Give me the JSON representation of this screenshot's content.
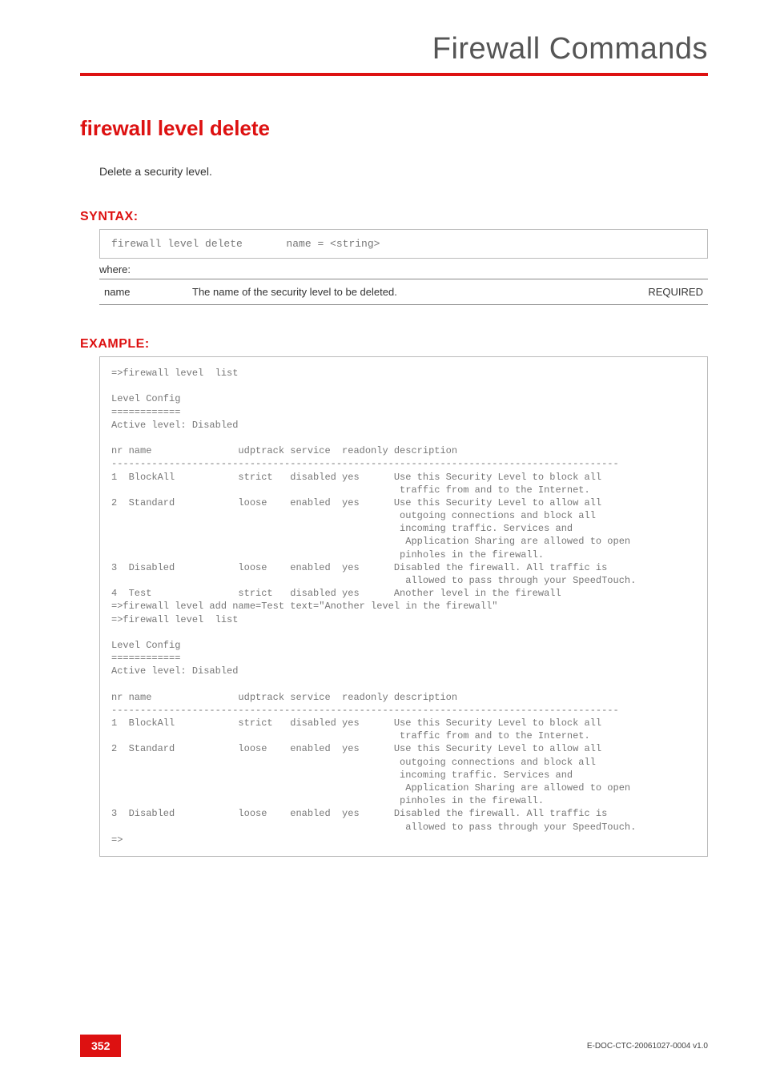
{
  "header": {
    "running_title": "Firewall Commands"
  },
  "command": {
    "title": "firewall level delete",
    "description": "Delete a security level."
  },
  "syntax": {
    "label": "SYNTAX:",
    "code": "firewall level delete       name = <string>",
    "where": "where:",
    "params": [
      {
        "name": "name",
        "desc": "The name of the security level to be deleted.",
        "req": "REQUIRED"
      }
    ]
  },
  "example": {
    "label": "EXAMPLE:",
    "text": "=>firewall level  list\n\nLevel Config\n============\nActive level: Disabled\n\nnr name               udptrack service  readonly description\n----------------------------------------------------------------------------------------\n1  BlockAll           strict   disabled yes      Use this Security Level to block all\n                                                  traffic from and to the Internet.\n2  Standard           loose    enabled  yes      Use this Security Level to allow all\n                                                  outgoing connections and block all\n                                                  incoming traffic. Services and\n                                                   Application Sharing are allowed to open\n                                                  pinholes in the firewall.\n3  Disabled           loose    enabled  yes      Disabled the firewall. All traffic is\n                                                   allowed to pass through your SpeedTouch.\n4  Test               strict   disabled yes      Another level in the firewall\n=>firewall level add name=Test text=\"Another level in the firewall\"\n=>firewall level  list\n\nLevel Config\n============\nActive level: Disabled\n\nnr name               udptrack service  readonly description\n----------------------------------------------------------------------------------------\n1  BlockAll           strict   disabled yes      Use this Security Level to block all\n                                                  traffic from and to the Internet.\n2  Standard           loose    enabled  yes      Use this Security Level to allow all\n                                                  outgoing connections and block all\n                                                  incoming traffic. Services and\n                                                   Application Sharing are allowed to open\n                                                  pinholes in the firewall.\n3  Disabled           loose    enabled  yes      Disabled the firewall. All traffic is\n                                                   allowed to pass through your SpeedTouch.\n=>"
  },
  "footer": {
    "page": "352",
    "docid": "E-DOC-CTC-20061027-0004 v1.0"
  }
}
